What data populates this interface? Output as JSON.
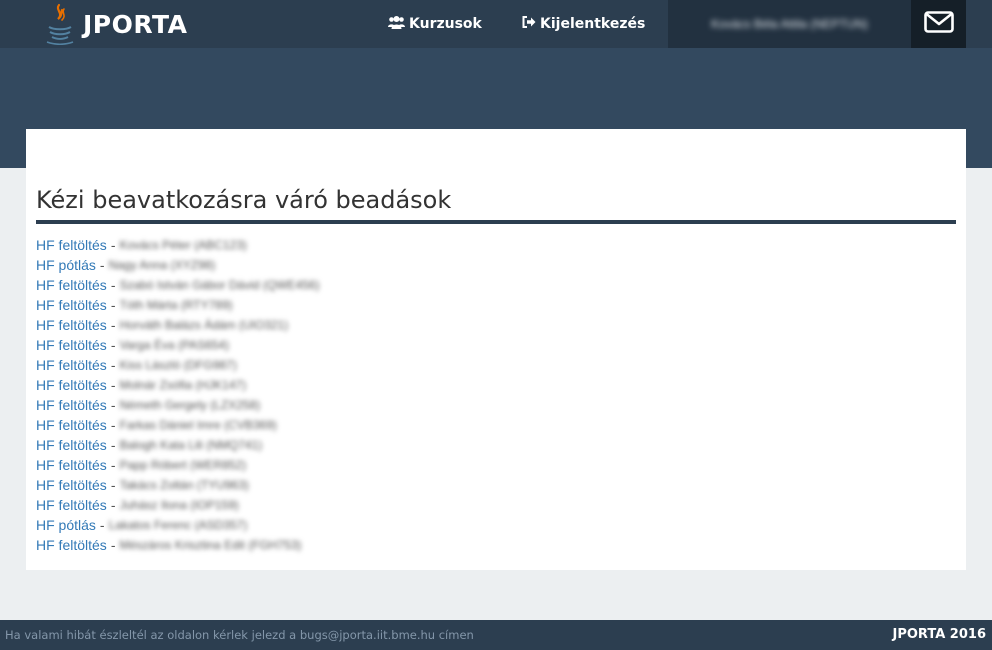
{
  "brand": {
    "name": "JPORTA",
    "logo_icon": "java-coffee-cup-icon"
  },
  "nav": {
    "courses": {
      "label": "Kurzusok",
      "icon": "users-icon"
    },
    "logout": {
      "label": "Kijelentkezés",
      "icon": "sign-out-icon"
    },
    "user_name": "Kovács Béla Attila (NEPTUN)",
    "mail_icon": "envelope-icon"
  },
  "main": {
    "title": "Kézi beavatkozásra váró beadások",
    "separator": "-",
    "items": [
      {
        "type": "HF feltöltés",
        "detail": "Kovács Péter (ABC123)"
      },
      {
        "type": "HF pótlás",
        "detail": "Nagy Anna (XYZ98)"
      },
      {
        "type": "HF feltöltés",
        "detail": "Szabó István Gábor Dávid (QWE456)"
      },
      {
        "type": "HF feltöltés",
        "detail": "Tóth Márta (RTY789)"
      },
      {
        "type": "HF feltöltés",
        "detail": "Horváth Balázs Ádám (UIO321)"
      },
      {
        "type": "HF feltöltés",
        "detail": "Varga Éva (PAS654)"
      },
      {
        "type": "HF feltöltés",
        "detail": "Kiss László (DFG987)"
      },
      {
        "type": "HF feltöltés",
        "detail": "Molnár Zsófia (HJK147)"
      },
      {
        "type": "HF feltöltés",
        "detail": "Németh Gergely (LZX258)"
      },
      {
        "type": "HF feltöltés",
        "detail": "Farkas Dániel Imre (CVB369)"
      },
      {
        "type": "HF feltöltés",
        "detail": "Balogh Kata Lili (NMQ741)"
      },
      {
        "type": "HF feltöltés",
        "detail": "Papp Róbert (WER852)"
      },
      {
        "type": "HF feltöltés",
        "detail": "Takács Zoltán (TYU963)"
      },
      {
        "type": "HF feltöltés",
        "detail": "Juhász Ilona (IOP159)"
      },
      {
        "type": "HF pótlás",
        "detail": "Lakatos Ferenc (ASD357)"
      },
      {
        "type": "HF feltöltés",
        "detail": "Mészáros Krisztina Edit (FGH753)"
      }
    ]
  },
  "footer": {
    "message": "Ha valami hibát észleltél az oldalon kérlek jelezd a bugs@jporta.iit.bme.hu címen",
    "copyright": "JPORTA 2016"
  },
  "colors": {
    "navbar": "#2c3e50",
    "header_band": "#33495f",
    "link": "#337ab7",
    "page_bg": "#eceff1"
  }
}
